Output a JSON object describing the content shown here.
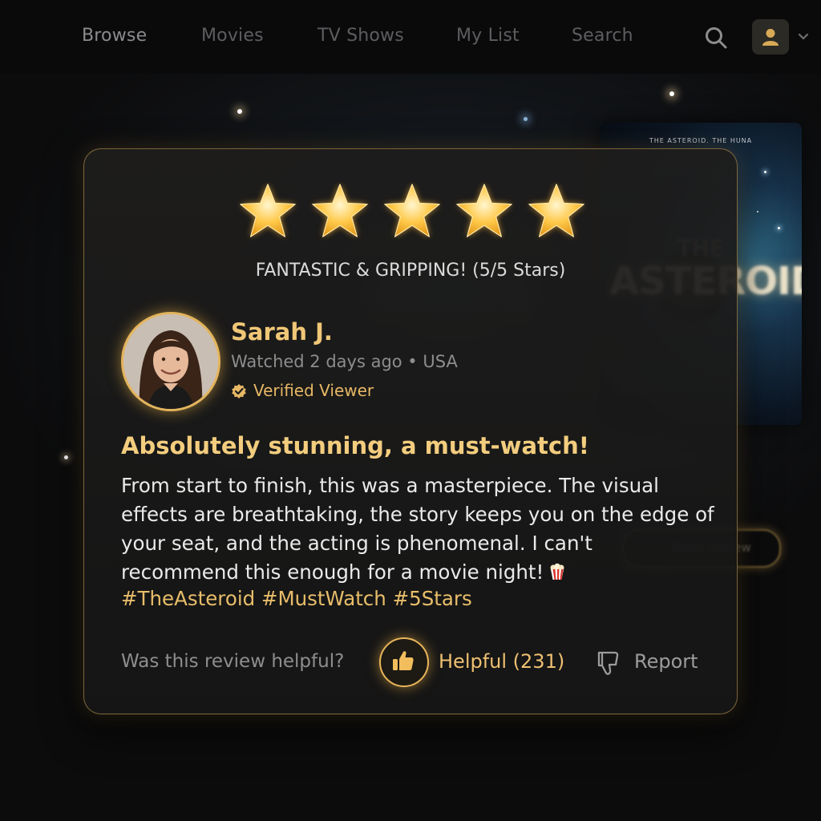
{
  "nav": {
    "items": [
      "Browse",
      "Movies",
      "TV Shows",
      "My List",
      "Search"
    ],
    "active": "Browse"
  },
  "poster": {
    "tagline": "THE ASTEROID. THE HUNA",
    "title_small": "THE",
    "title": "ASTEROID"
  },
  "show_review_button": "Show Review",
  "review": {
    "rating": 5,
    "rating_max": 5,
    "rating_text": "FANTASTIC & GRIPPING! (5/5 Stars)",
    "reviewer_name": "Sarah J.",
    "meta": "Watched 2 days ago • USA",
    "verified_label": "Verified Viewer",
    "title": "Absolutely stunning, a must-watch!",
    "body": "From start to finish, this was a masterpiece. The visual effects are breathtaking, the story keeps you on the edge of your seat, and the acting is phenomenal. I can't recommend this enough for a movie night!",
    "hashtags": "#TheAsteroid #MustWatch #5Stars",
    "helpful_question": "Was this review helpful?",
    "helpful_label": "Helpful (231)",
    "report_label": "Report"
  },
  "colors": {
    "accent_gold": "#f0c777",
    "background": "#0d0d0e",
    "card": "#1c1b1a"
  },
  "icons": [
    "search-icon",
    "user-icon",
    "chevron-down-icon",
    "star-icon",
    "verified-badge-icon",
    "popcorn-icon",
    "thumbs-up-icon",
    "thumbs-down-icon"
  ]
}
